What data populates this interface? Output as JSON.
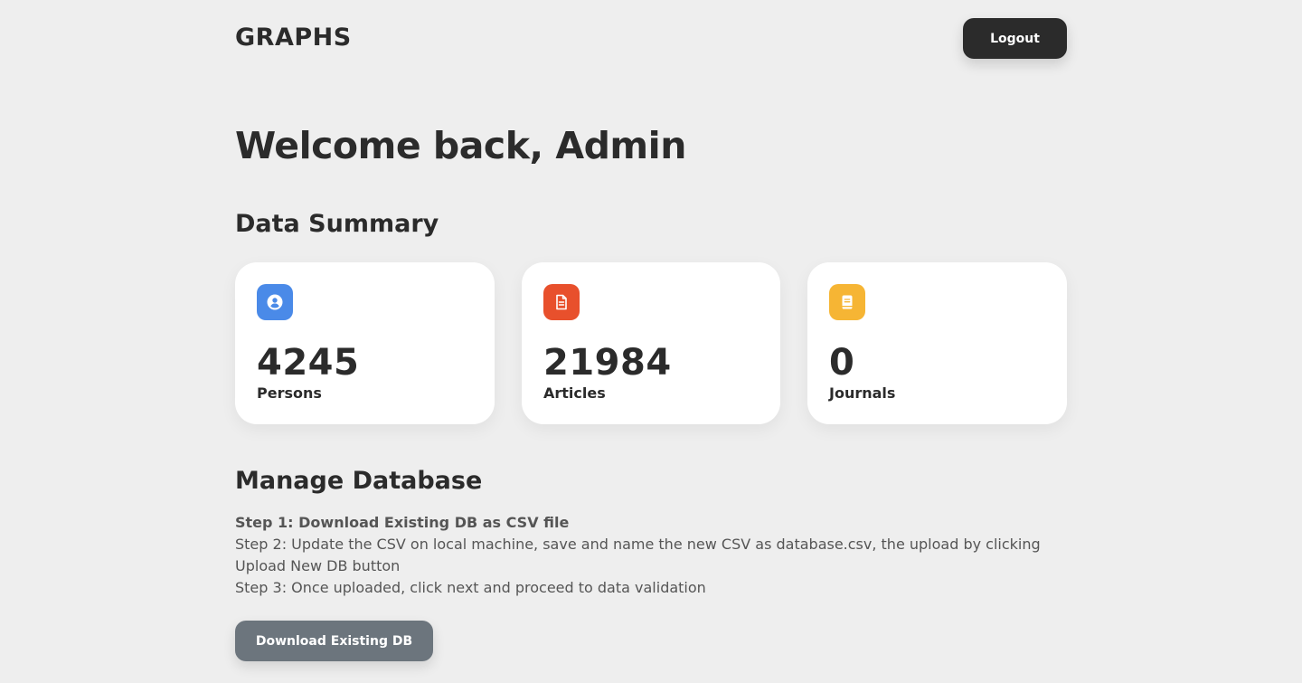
{
  "header": {
    "brand": "GRAPHS",
    "logout_label": "Logout"
  },
  "welcome": {
    "title": "Welcome back, Admin"
  },
  "summary": {
    "title": "Data Summary",
    "cards": [
      {
        "icon": "user-icon",
        "value": "4245",
        "label": "Persons",
        "color": "#4a8ae8"
      },
      {
        "icon": "document-icon",
        "value": "21984",
        "label": "Articles",
        "color": "#e8502c"
      },
      {
        "icon": "book-icon",
        "value": "0",
        "label": "Journals",
        "color": "#f6b534"
      }
    ]
  },
  "manage": {
    "title": "Manage Database",
    "step1": "Step 1: Download Existing DB as CSV file",
    "step2": "Step 2: Update the CSV on local machine, save and name the new CSV as database.csv, the upload by clicking Upload New DB button",
    "step3": "Step 3: Once uploaded, click next and proceed to data validation",
    "download_label": "Download Existing DB"
  },
  "colors": {
    "background": "#eeeeee",
    "dark_button": "#2b2b2b",
    "secondary_button": "#6c757d"
  }
}
